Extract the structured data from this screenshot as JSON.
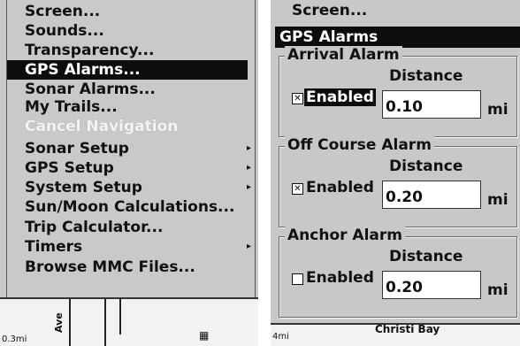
{
  "left_menu": {
    "items": [
      {
        "label": "Screen...",
        "state": "normal"
      },
      {
        "label": "Sounds...",
        "state": "normal"
      },
      {
        "label": "Transparency...",
        "state": "normal"
      },
      {
        "label": "GPS Alarms...",
        "state": "selected"
      },
      {
        "label": "Sonar Alarms...",
        "state": "normal"
      },
      {
        "label": "My Trails...",
        "state": "normal"
      },
      {
        "label": "Cancel Navigation",
        "state": "disabled"
      },
      {
        "label": "Sonar Setup",
        "state": "submenu"
      },
      {
        "label": "GPS Setup",
        "state": "submenu"
      },
      {
        "label": "System Setup",
        "state": "submenu"
      },
      {
        "label": "Sun/Moon Calculations...",
        "state": "normal"
      },
      {
        "label": "Trip Calculator...",
        "state": "normal"
      },
      {
        "label": "Timers",
        "state": "submenu"
      },
      {
        "label": "Browse MMC Files...",
        "state": "normal"
      }
    ],
    "submenu_arrow": "▸"
  },
  "left_map": {
    "scale": "0.3mi",
    "road_label": "Ave"
  },
  "right_screen": {
    "top_item": "Screen...",
    "title": "GPS Alarms",
    "alarms": [
      {
        "title": "Arrival Alarm",
        "distance_label": "Distance",
        "enabled_label": "Enabled",
        "checked": true,
        "focused": true,
        "value": "0.10",
        "unit": "mi"
      },
      {
        "title": "Off Course Alarm",
        "distance_label": "Distance",
        "enabled_label": "Enabled",
        "checked": true,
        "focused": false,
        "value": "0.20",
        "unit": "mi"
      },
      {
        "title": "Anchor Alarm",
        "distance_label": "Distance",
        "enabled_label": "Enabled",
        "checked": false,
        "focused": false,
        "value": "0.20",
        "unit": "mi"
      }
    ],
    "map_scale": "4mi",
    "map_label": "Christi Bay"
  },
  "colors": {
    "highlight": "#0d0d0d",
    "panel": "#c8c8c8"
  }
}
